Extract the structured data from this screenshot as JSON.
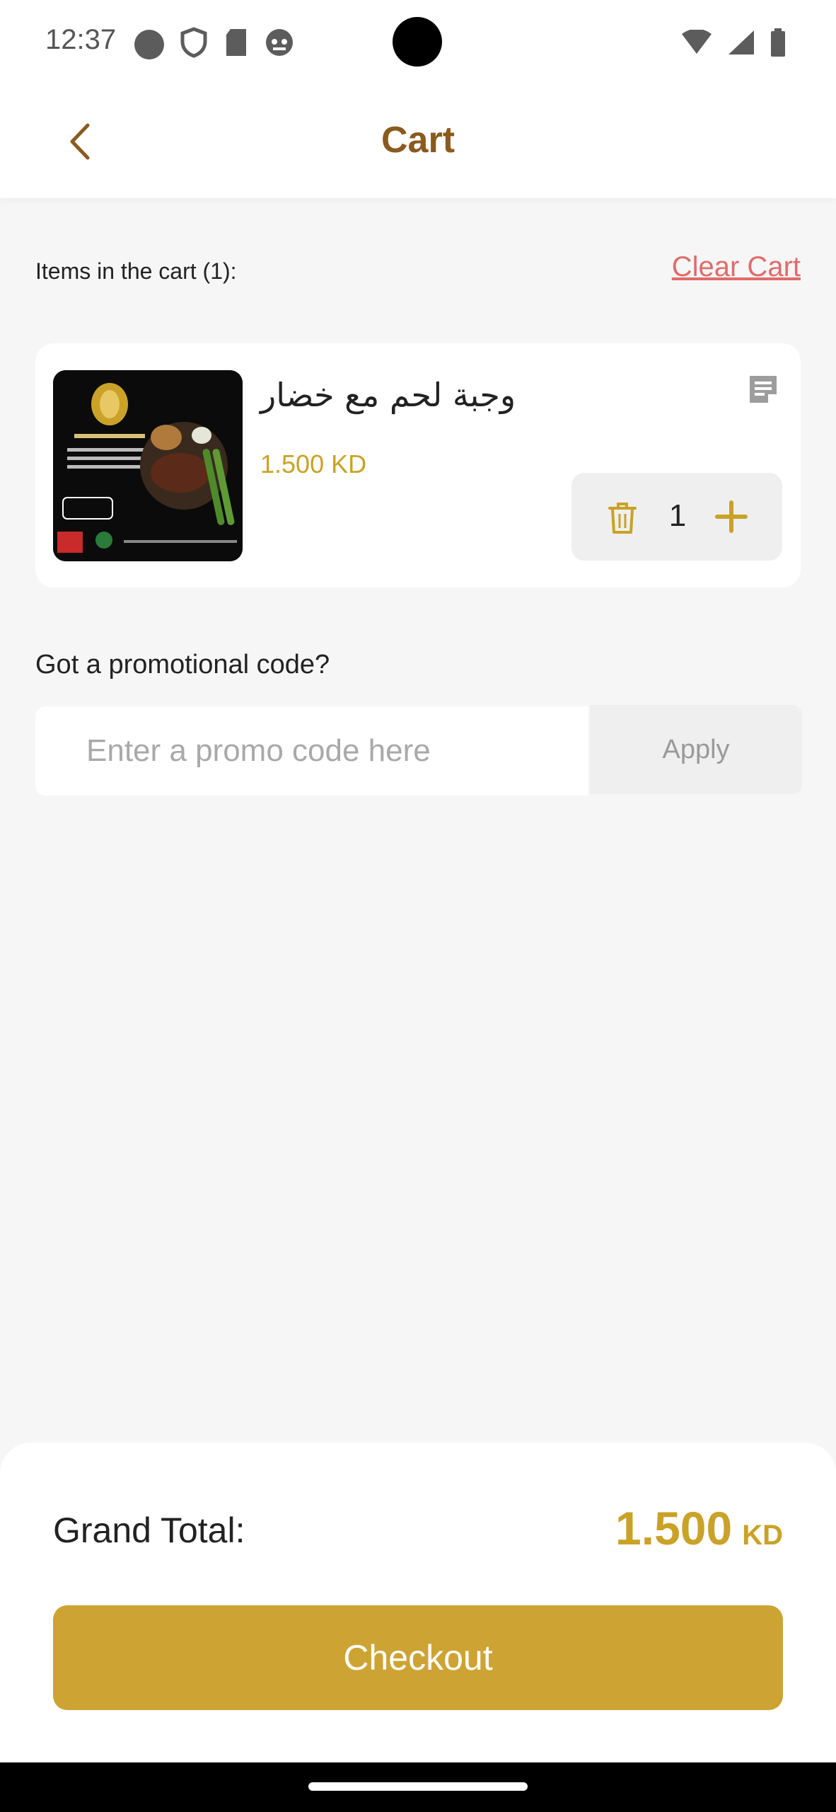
{
  "status_bar": {
    "time": "12:37"
  },
  "header": {
    "title": "Cart",
    "back_icon": "chevron-left-icon"
  },
  "cart": {
    "items_label": "Items in the cart (1):",
    "clear_label": "Clear Cart",
    "items": [
      {
        "name": "وجبة لحم مع خضار",
        "price": "1.500 KD",
        "quantity": "1"
      }
    ]
  },
  "promo": {
    "label": "Got a promotional code?",
    "placeholder": "Enter a promo code here",
    "apply_label": "Apply"
  },
  "summary": {
    "grand_total_label": "Grand Total:",
    "grand_total_value": "1.500",
    "currency": "KD",
    "checkout_label": "Checkout"
  },
  "colors": {
    "accent": "#cda433",
    "title": "#8a5a1e",
    "danger": "#e06b6b"
  }
}
